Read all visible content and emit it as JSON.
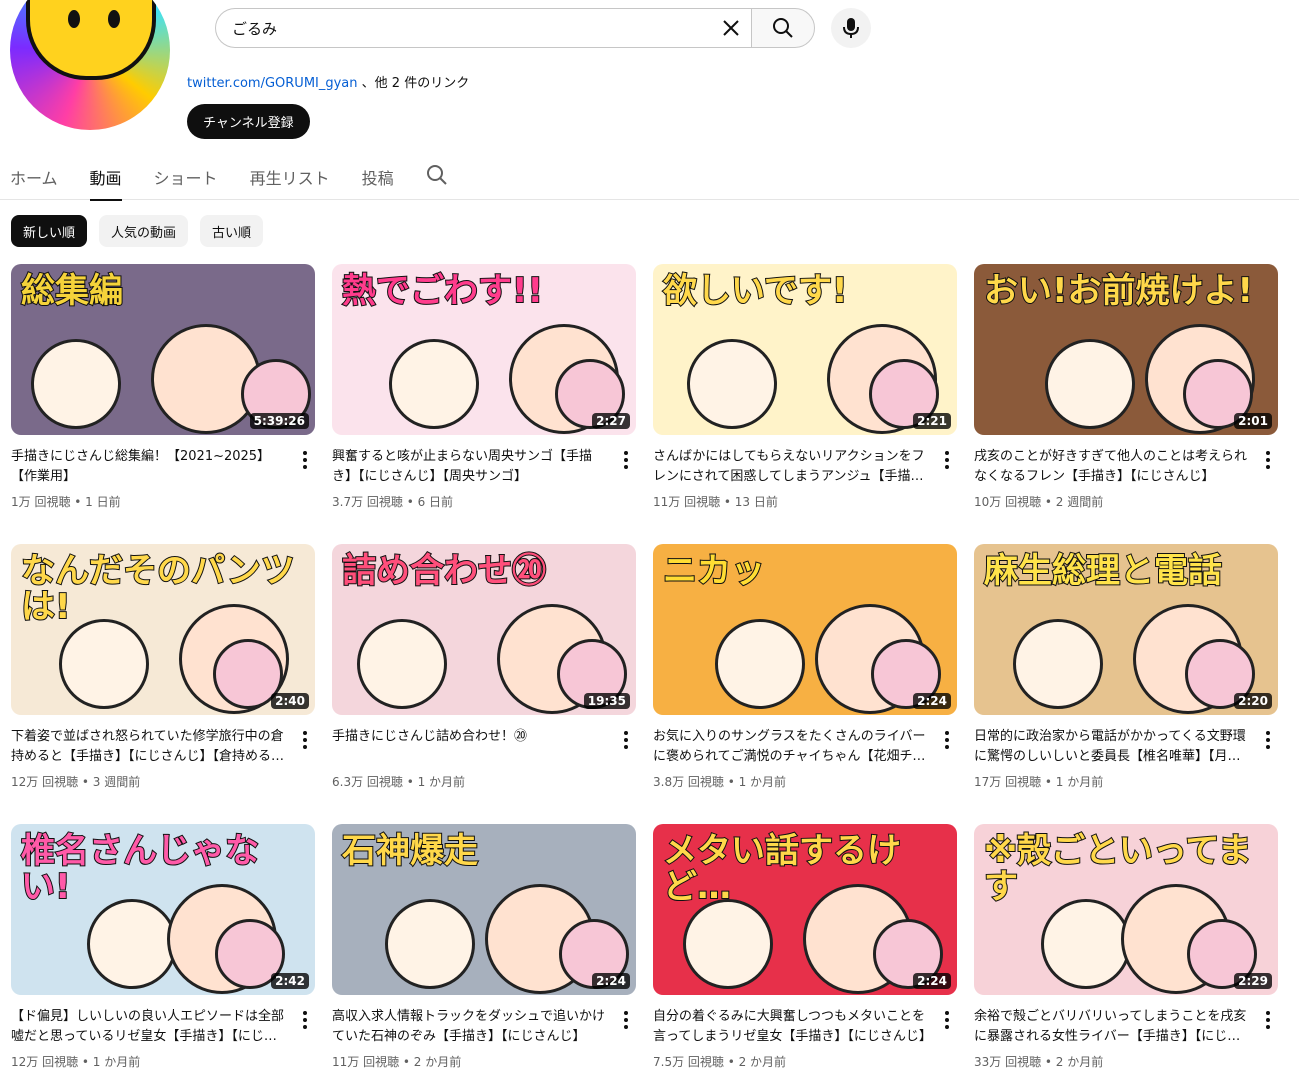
{
  "search": {
    "query": "ごるみ"
  },
  "channel": {
    "link_text": "twitter.com/GORUMI_gyan",
    "link_suffix": "、他 2 件のリンク",
    "subscribe_label": "チャンネル登録"
  },
  "tabs": [
    {
      "label": "ホーム"
    },
    {
      "label": "動画"
    },
    {
      "label": "ショート"
    },
    {
      "label": "再生リスト"
    },
    {
      "label": "投稿"
    }
  ],
  "chips": [
    {
      "label": "新しい順"
    },
    {
      "label": "人気の動画"
    },
    {
      "label": "古い順"
    }
  ],
  "videos": [
    {
      "thumb_text": "総集編",
      "duration": "5:39:26",
      "title": "手描きにじさんじ総集編！【2021~2025】【作業用】",
      "stats": "1万 回視聴 • 1 日前",
      "bg": "#7a6a8a",
      "text_color": "#f5d33a"
    },
    {
      "thumb_text": "熱でごわす!!",
      "duration": "2:27",
      "title": "興奮すると咳が止まらない周央サンゴ【手描き】【にじさんじ】【周央サンゴ】",
      "stats": "3.7万 回視聴 • 6 日前",
      "bg": "#fbe3ec",
      "text_color": "#ff3c8c"
    },
    {
      "thumb_text": "欲しいです!",
      "duration": "2:21",
      "title": "さんばかにはしてもらえないリアクションをフレンにされて困惑してしまうアンジュ【手描き】【にじさんじ】",
      "stats": "11万 回視聴 • 13 日前",
      "bg": "#fff3c9",
      "text_color": "#ffd84a"
    },
    {
      "thumb_text": "おい!お前焼けよ!",
      "duration": "2:01",
      "title": "戌亥のことが好きすぎて他人のことは考えられなくなるフレン【手描き】【にじさんじ】",
      "stats": "10万 回視聴 • 2 週間前",
      "bg": "#8b5a3a",
      "text_color": "#ffd84a"
    },
    {
      "thumb_text": "なんだそのパンツは!",
      "duration": "2:40",
      "title": "下着姿で並ばされ怒られていた修学旅行中の倉持めると【手描き】【にじさんじ】【倉持めると】",
      "stats": "12万 回視聴 • 3 週間前",
      "bg": "#f6e9d6",
      "text_color": "#ffd84a"
    },
    {
      "thumb_text": "詰め合わせ⑳",
      "duration": "19:35",
      "title": "手描きにじさんじ詰め合わせ！⑳",
      "stats": "6.3万 回視聴 • 1 か月前",
      "bg": "#f4d6dc",
      "text_color": "#ff4f7b"
    },
    {
      "thumb_text": "ニカッ",
      "duration": "2:24",
      "title": "お気に入りのサングラスをたくさんのライバーに褒められてご満悦のチャイちゃん【花畑チャイカ】",
      "stats": "3.8万 回視聴 • 1 か月前",
      "bg": "#f7b043",
      "text_color": "#ffdd33"
    },
    {
      "thumb_text": "麻生総理と電話",
      "duration": "2:20",
      "title": "日常的に政治家から電話がかかってくる文野環に驚愕のしいしいと委員長【椎名唯華】【月ノ美兎】",
      "stats": "17万 回視聴 • 1 か月前",
      "bg": "#e6c38f",
      "text_color": "#ffe34a"
    },
    {
      "thumb_text": "椎名さんじゃない!",
      "duration": "2:42",
      "title": "【ド偏見】しいしいの良い人エピソードは全部嘘だと思っているリゼ皇女【手描き】【にじさんじ】",
      "stats": "12万 回視聴 • 1 か月前",
      "bg": "#cfe3ef",
      "text_color": "#ff5aa8"
    },
    {
      "thumb_text": "石神爆走",
      "duration": "2:24",
      "title": "高収入求人情報トラックをダッシュで追いかけていた石神のぞみ【手描き】【にじさんじ】",
      "stats": "11万 回視聴 • 2 か月前",
      "bg": "#a7b0bd",
      "text_color": "#ffd84a"
    },
    {
      "thumb_text": "メタい話するけど…",
      "duration": "2:24",
      "title": "自分の着ぐるみに大興奮しつつもメタいことを言ってしまうリゼ皇女【手描き】【にじさんじ】",
      "stats": "7.5万 回視聴 • 2 か月前",
      "bg": "#e7304a",
      "text_color": "#ffd84a"
    },
    {
      "thumb_text": "※殻ごといってます",
      "duration": "2:29",
      "title": "余裕で殻ごとバリバリいってしまうことを戌亥に暴露される女性ライバー【手描き】【にじさんじ】",
      "stats": "33万 回視聴 • 2 か月前",
      "bg": "#f7d2d8",
      "text_color": "#ffd84a"
    }
  ]
}
